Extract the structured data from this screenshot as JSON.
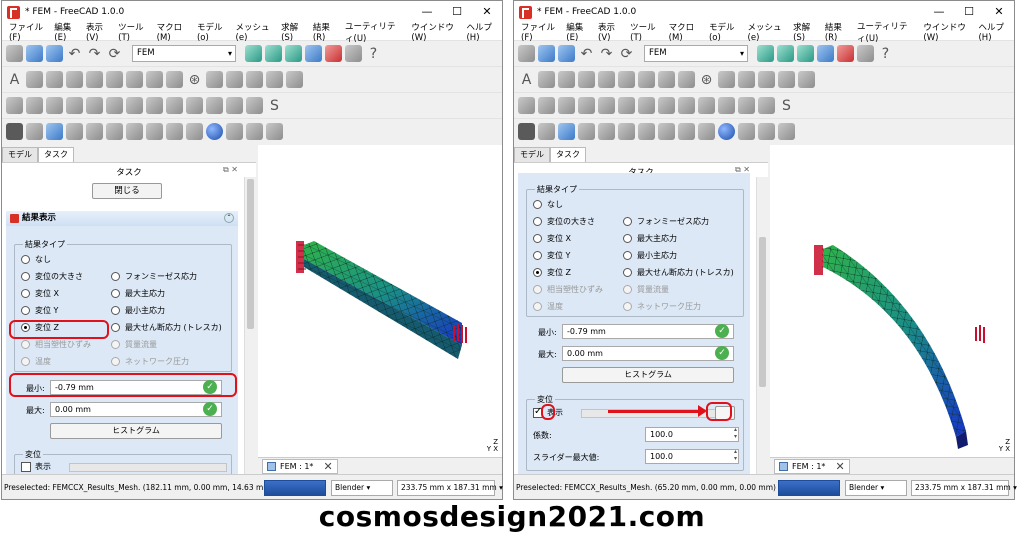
{
  "windows": [
    {
      "title": "* FEM - FreeCAD 1.0.0",
      "menu": [
        "ファイル(F)",
        "編集(E)",
        "表示(V)",
        "ツール(T)",
        "マクロ(M)",
        "モデル(o)",
        "メッシュ(e)",
        "求解(S)",
        "結果(R)",
        "ユーティリティ(U)",
        "ウインドウ(W)",
        "ヘルプ(H)"
      ],
      "workbench": "FEM",
      "tabs": [
        "モデル",
        "タスク"
      ],
      "panel_title": "タスク",
      "close_button": "閉じる",
      "section_title": "結果表示",
      "result_type_label": "結果タイプ",
      "radios_left": [
        "なし",
        "変位の大きさ",
        "変位 X",
        "変位 Y",
        "変位 Z",
        "相当塑性ひずみ",
        "温度"
      ],
      "radios_right": [
        "フォンミーゼス応力",
        "最大主応力",
        "最小主応力",
        "最大せん断応力 (トレスカ)",
        "質量流量",
        "ネットワーク圧力"
      ],
      "selected_radio": "変位 Z",
      "min_label": "最小:",
      "min_value": "-0.79 mm",
      "max_label": "最大:",
      "max_value": "0.00 mm",
      "histogram_button": "ヒストグラム",
      "displacement_label": "変位",
      "show_label": "表示",
      "show_checked": false,
      "doc_tab": "FEM : 1*",
      "status": "Preselected: FEMCCX_Results_Mesh. (182.11 mm, 0.00 mm, 14.63 mm)",
      "nav_style": "Blender",
      "dimensions": "233.75 mm x 187.31 mm"
    },
    {
      "title": "* FEM - FreeCAD 1.0.0",
      "menu": [
        "ファイル(F)",
        "編集(E)",
        "表示(V)",
        "ツール(T)",
        "マクロ(M)",
        "モデル(o)",
        "メッシュ(e)",
        "求解(S)",
        "結果(R)",
        "ユーティリティ(U)",
        "ウインドウ(W)",
        "ヘルプ(H)"
      ],
      "workbench": "FEM",
      "tabs": [
        "モデル",
        "タスク"
      ],
      "panel_title": "タスク",
      "result_type_label": "結果タイプ",
      "radios_left": [
        "なし",
        "変位の大きさ",
        "変位 X",
        "変位 Y",
        "変位 Z",
        "相当塑性ひずみ",
        "温度"
      ],
      "radios_right": [
        "フォンミーゼス応力",
        "最大主応力",
        "最小主応力",
        "最大せん断応力 (トレスカ)",
        "質量流量",
        "ネットワーク圧力"
      ],
      "selected_radio": "変位 Z",
      "min_label": "最小:",
      "min_value": "-0.79 mm",
      "max_label": "最大:",
      "max_value": "0.00 mm",
      "histogram_button": "ヒストグラム",
      "displacement_label": "変位",
      "show_label": "表示",
      "show_checked": true,
      "factor_label": "係数:",
      "factor_value": "100.0",
      "slider_max_label": "スライダー最大値:",
      "slider_max_value": "100.0",
      "doc_tab": "FEM : 1*",
      "status": "Preselected: FEMCCX_Results_Mesh. (65.20 mm, 0.00 mm, 0.00 mm)",
      "nav_style": "Blender",
      "dimensions": "233.75 mm x 187.31 mm"
    }
  ],
  "axis_labels": {
    "z": "Z",
    "y": "Y",
    "x": "X"
  },
  "footer": "cosmosdesign2021.com",
  "colors": {
    "annotation_red": "#e0111a",
    "panel_blue": "#dce8f6",
    "fem_red": "#d93025"
  }
}
